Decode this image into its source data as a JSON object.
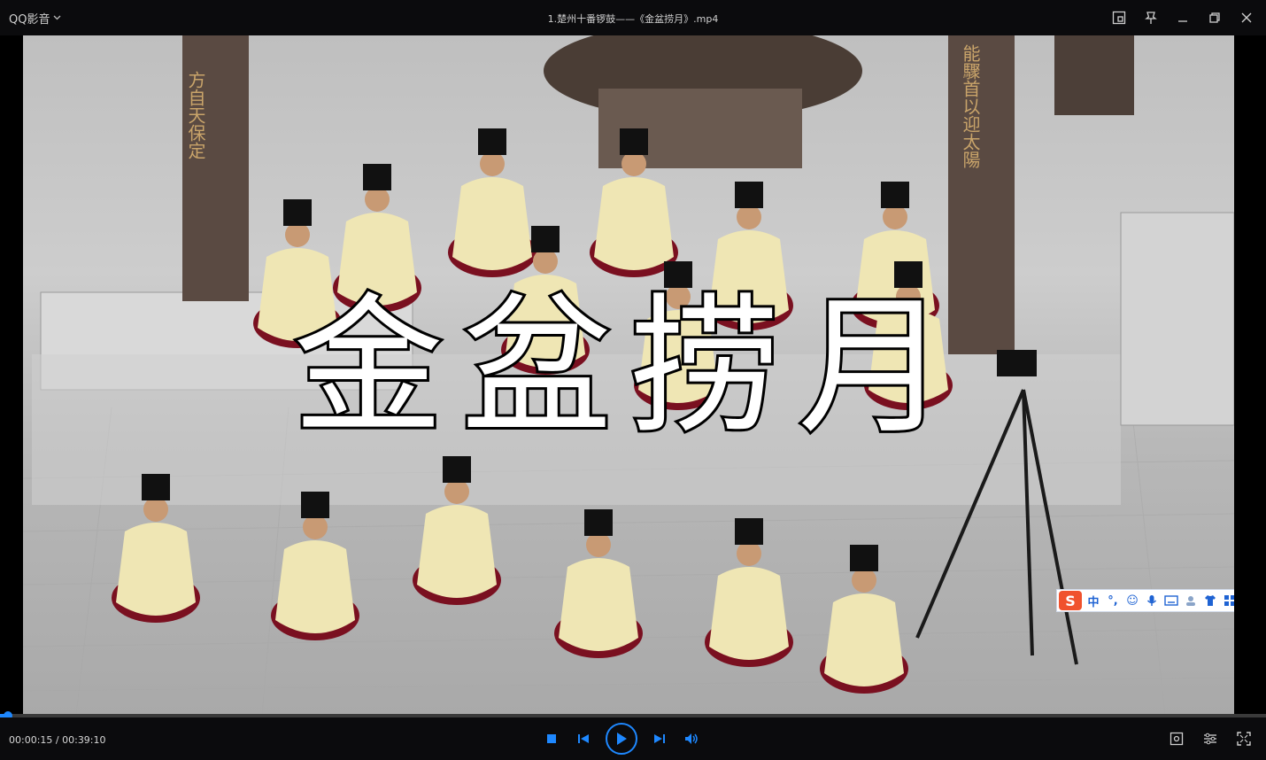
{
  "app": {
    "name": "QQ影音",
    "menu_chevron": "chevron-down-icon"
  },
  "file": {
    "title": "1.楚州十番锣鼓——《金盆捞月》.mp4"
  },
  "window_controls": {
    "icons": [
      "screenshot-icon",
      "pin-icon",
      "minimize-icon",
      "restore-icon",
      "close-icon"
    ]
  },
  "video": {
    "overlay_caption": "金盆捞月",
    "pillar_left_text": "方自天保定",
    "pillar_right_text": "能驟首以迎太陽"
  },
  "ime": {
    "logo": "S",
    "items": [
      "中",
      "°,",
      "☺",
      "mic",
      "keyboard",
      "user",
      "shirt",
      "grid"
    ]
  },
  "playback": {
    "current_time": "00:00:15",
    "total_time": "00:39:10",
    "progress_fraction": 0.0064,
    "accent": "#1e88ff"
  },
  "controls": {
    "center": [
      "stop-icon",
      "previous-icon",
      "play-icon",
      "next-icon",
      "volume-icon"
    ],
    "right": [
      "snapshot-icon",
      "settings-icon",
      "fullscreen-icon"
    ]
  }
}
